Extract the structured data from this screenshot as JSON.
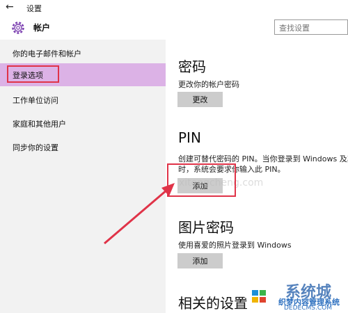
{
  "titlebar": {
    "title": "设置"
  },
  "header": {
    "title": "帐户"
  },
  "search": {
    "placeholder": "查找设置"
  },
  "sidebar": {
    "items": [
      {
        "label": "你的电子邮件和帐户"
      },
      {
        "label": "登录选项"
      },
      {
        "label": "工作单位访问"
      },
      {
        "label": "家庭和其他用户"
      },
      {
        "label": "同步你的设置"
      }
    ],
    "selected_index": 1
  },
  "password": {
    "title": "密码",
    "desc": "更改你的帐户密码",
    "button": "更改"
  },
  "pin": {
    "title": "PIN",
    "desc_line1": "创建可替代密码的 PIN。当你登录到 Windows 及其",
    "desc_line2": "时，系统会要求你输入此 PIN。",
    "button": "添加"
  },
  "picture": {
    "title": "图片密码",
    "desc": "使用喜爱的照片登录到 Windows",
    "button": "添加"
  },
  "related": {
    "title": "相关的设置"
  },
  "watermark": {
    "main": "系统城",
    "sub": "织梦内容管理系统",
    "url": "DEDECMS.COM",
    "ghost": "xitongcheng.com"
  },
  "colors": {
    "accent_selected": "#dcb2e6",
    "annotation_red": "#e03348"
  }
}
